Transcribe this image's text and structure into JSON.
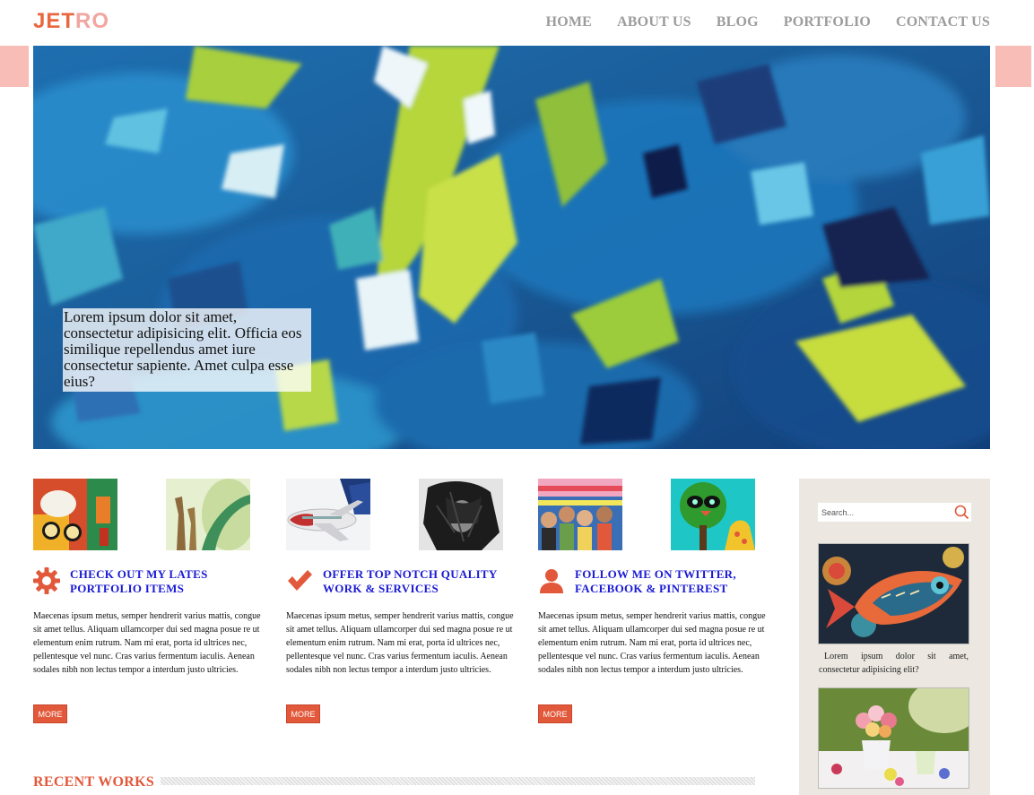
{
  "header": {
    "logo_main": "JET",
    "logo_accent": "RO",
    "nav": [
      "HOME",
      "ABOUT US",
      "BLOG",
      "PORTFOLIO",
      "CONTACT US"
    ]
  },
  "hero": {
    "caption": "Lorem ipsum dolor sit amet, consectetur adipisicing elit. Officia eos similique repellendus amet iure consectetur sapiente. Amet culpa esse eius?"
  },
  "features": [
    {
      "icon": "gear-icon",
      "title": "CHECK OUT MY LATES PORTFOLIO ITEMS",
      "text": "Maecenas ipsum metus, semper hendrerit varius mattis, congue sit amet tellus. Aliquam ullamcorper dui sed magna posue re ut elementum enim rutrum. Nam mi erat, porta id ultrices nec, pellentesque vel nunc. Cras varius fermentum iaculis. Aenean sodales nibh non lectus tempor a interdum justo ultricies.",
      "button": "MORE"
    },
    {
      "icon": "checkmark-icon",
      "title": "OFFER TOP NOTCH QUALITY WORK & SERVICES",
      "text": "Maecenas ipsum metus, semper hendrerit varius mattis, congue sit amet tellus. Aliquam ullamcorper dui sed magna posue re ut elementum enim rutrum. Nam mi erat, porta id ultrices nec, pellentesque vel nunc. Cras varius fermentum iaculis. Aenean sodales nibh non lectus tempor a interdum justo ultricies.",
      "button": "MORE"
    },
    {
      "icon": "user-icon",
      "title": "FOLLOW ME ON TWITTER, FACEBOOK & PINTEREST",
      "text": "Maecenas ipsum metus, semper hendrerit varius mattis, congue sit amet tellus. Aliquam ullamcorper dui sed magna posue re ut elementum enim rutrum. Nam mi erat, porta id ultrices nec, pellentesque vel nunc. Cras varius fermentum iaculis. Aenean sodales nibh non lectus tempor a interdum justo ultricies.",
      "button": "MORE"
    }
  ],
  "recent": {
    "title": "RECENT WORKS"
  },
  "sidebar": {
    "search_placeholder": "Search...",
    "caption": "Lorem ipsum dolor sit amet, consectetur adipisicing elit?"
  },
  "colors": {
    "accent": "#e2583a",
    "heading_blue": "#1a1ad4",
    "nav_gray": "#9c9c9c",
    "sidebar_bg": "#ece8e1"
  }
}
